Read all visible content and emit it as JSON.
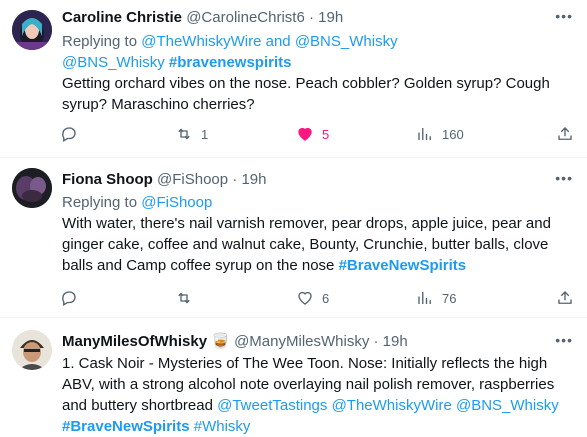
{
  "tweets": [
    {
      "name": "Caroline Christie",
      "handle": "@CarolineChrist6",
      "sep": "·",
      "time": "19h",
      "replying_prefix": "Replying to",
      "mention1": "@TheWhiskyWire",
      "and_word": "and",
      "mention2": "@BNS_Whisky",
      "mention3": "@BNS_Whisky",
      "hashtag": "#bravenewspirits",
      "text": "Getting orchard vibes on the nose. Peach cobbler? Golden syrup? Cough syrup? Maraschino cherries?",
      "retweets": "1",
      "likes": "5",
      "views": "160"
    },
    {
      "name": "Fiona Shoop",
      "handle": "@FiShoop",
      "sep": "·",
      "time": "19h",
      "replying_prefix": "Replying to",
      "mention1": "@FiShoop",
      "text": "With water, there's nail varnish remover, pear drops, apple juice, pear and ginger cake, coffee and walnut cake, Bounty, Crunchie, butter balls, clove balls and Camp coffee syrup on the nose",
      "hashtag": "#BraveNewSpirits",
      "retweets": "",
      "likes": "6",
      "views": "76"
    },
    {
      "name": "ManyMilesOfWhisky",
      "emoji": "🥃",
      "handle": "@ManyMilesWhisky",
      "sep": "·",
      "time": "19h",
      "text": "1. Cask Noir - Mysteries of The Wee Toon. Nose: Initially reflects the high ABV, with a strong alcohol note overlaying nail polish remover, raspberries and buttery shortbread",
      "mention1": "@TweetTastings",
      "mention2": "@TheWhiskyWire",
      "mention3": "@BNS_Whisky",
      "hashtag1": "#BraveNewSpirits",
      "hashtag2": "#Whisky"
    }
  ],
  "more_icon": "more-dots-icon",
  "colors": {
    "link": "#1d9bf0",
    "secondary": "#536471",
    "like": "#f91880"
  }
}
